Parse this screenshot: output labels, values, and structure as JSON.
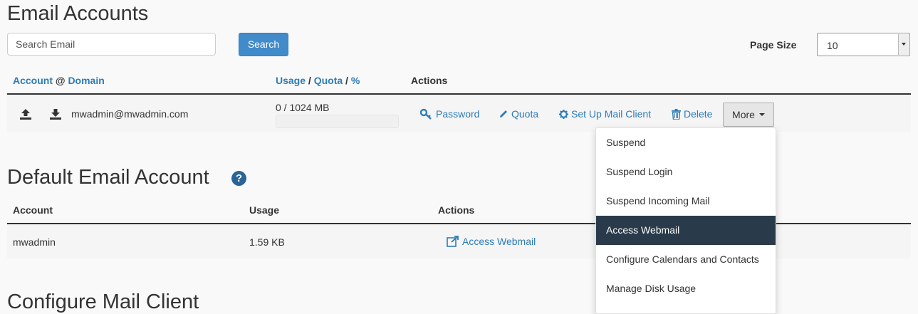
{
  "email_accounts": {
    "title": "Email Accounts",
    "search_placeholder": "Search Email",
    "search_label": "Search",
    "page_size_label": "Page Size",
    "page_size_value": "10",
    "headers": {
      "account": "Account",
      "at": "@",
      "domain": "Domain",
      "usage": "Usage",
      "slash1": "/",
      "quota": "Quota",
      "slash2": "/",
      "percent": "%",
      "actions": "Actions"
    },
    "rows": [
      {
        "email": "mwadmin@mwadmin.com",
        "usage": "0 / 1024 MB",
        "usage_fraction": 0,
        "actions": {
          "password": "Password",
          "quota": "Quota",
          "mail_client": "Set Up Mail Client",
          "delete": "Delete",
          "more": "More"
        }
      }
    ],
    "more_menu": [
      {
        "label": "Suspend",
        "active": false
      },
      {
        "label": "Suspend Login",
        "active": false
      },
      {
        "label": "Suspend Incoming Mail",
        "active": false
      },
      {
        "label": "Access Webmail",
        "active": true
      },
      {
        "label": "Configure Calendars and Contacts",
        "active": false
      },
      {
        "label": "Manage Disk Usage",
        "active": false
      }
    ]
  },
  "default_account": {
    "title": "Default Email Account",
    "headers": {
      "account": "Account",
      "usage": "Usage",
      "actions": "Actions"
    },
    "row": {
      "account": "mwadmin",
      "usage": "1.59 KB",
      "action": "Access Webmail"
    }
  },
  "next_section_title": "Configure Mail Client",
  "colors": {
    "link": "#2e7cb8",
    "primary_button": "#428bca",
    "menu_active": "#293a4a"
  }
}
